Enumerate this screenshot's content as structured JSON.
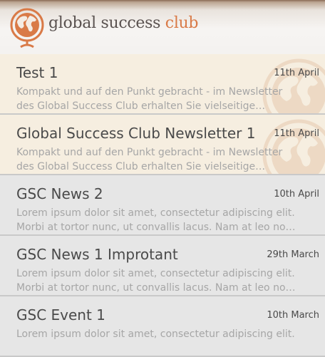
{
  "header": {
    "brand_main": "global success ",
    "brand_accent": "club",
    "logo_icon": "globe-logo-icon",
    "colors": {
      "accent": "#d97a47",
      "text": "#5a5250"
    }
  },
  "newsletters": [
    {
      "title": "Test 1",
      "date": "11th April",
      "snippet_line1": "Kompakt und auf den Punkt gebracht - im Newsletter",
      "snippet_line2": "des Global Success Club erhalten Sie vielseitige…",
      "unread": true
    },
    {
      "title": "Global Success Club Newsletter 1",
      "date": "11th April",
      "snippet_line1": "Kompakt und auf den Punkt gebracht - im Newsletter",
      "snippet_line2": "des Global Success Club erhalten Sie vielseitige…",
      "unread": true
    },
    {
      "title": "GSC News 2",
      "date": "10th April",
      "snippet_line1": "Lorem ipsum dolor sit amet, consectetur adipiscing elit.",
      "snippet_line2": "Morbi at tortor nunc, ut convallis lacus. Nam at leo no…",
      "unread": false
    },
    {
      "title": "GSC News 1 Improtant",
      "date": "29th March",
      "snippet_line1": "Lorem ipsum dolor sit amet, consectetur adipiscing elit.",
      "snippet_line2": "Morbi at tortor nunc, ut convallis lacus. Nam at leo no…",
      "unread": false
    },
    {
      "title": "GSC Event 1",
      "date": "10th March",
      "snippet_line1": "Lorem ipsum dolor sit amet, consectetur adipiscing elit.",
      "snippet_line2": "",
      "unread": false
    }
  ]
}
